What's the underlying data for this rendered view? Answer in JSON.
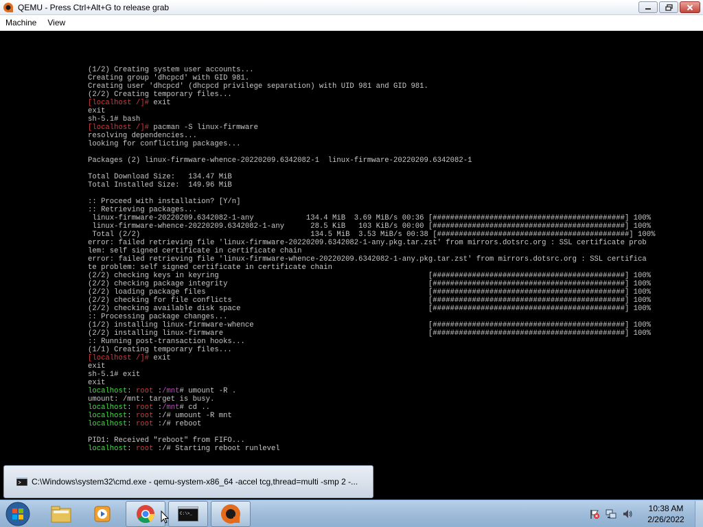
{
  "window": {
    "title": "QEMU - Press Ctrl+Alt+G to release grab",
    "menu": [
      "Machine",
      "View"
    ]
  },
  "terminal_lines": [
    [
      {
        "t": "(1/2) Creating system user accounts..."
      }
    ],
    [
      {
        "t": "Creating group 'dhcpcd' with GID 981."
      }
    ],
    [
      {
        "t": "Creating user 'dhcpcd' (dhcpcd privilege separation) with UID 981 and GID 981."
      }
    ],
    [
      {
        "t": "(2/2) Creating temporary files..."
      }
    ],
    [
      {
        "t": "[localhost /]# ",
        "c": "red"
      },
      {
        "t": "exit"
      }
    ],
    [
      {
        "t": "exit"
      }
    ],
    [
      {
        "t": "sh-5.1# bash"
      }
    ],
    [
      {
        "t": "[localhost /]# ",
        "c": "red"
      },
      {
        "t": "pacman -S linux-firmware"
      }
    ],
    [
      {
        "t": "resolving dependencies..."
      }
    ],
    [
      {
        "t": "looking for conflicting packages..."
      }
    ],
    [
      {
        "t": ""
      }
    ],
    [
      {
        "t": "Packages (2) linux-firmware-whence-20220209.6342082-1  linux-firmware-20220209.6342082-1"
      }
    ],
    [
      {
        "t": ""
      }
    ],
    [
      {
        "t": "Total Download Size:   134.47 MiB"
      }
    ],
    [
      {
        "t": "Total Installed Size:  149.96 MiB"
      }
    ],
    [
      {
        "t": ""
      }
    ],
    [
      {
        "t": ":: Proceed with installation? [Y/n]"
      }
    ],
    [
      {
        "t": ":: Retrieving packages..."
      }
    ],
    [
      {
        "t": " linux-firmware-20220209.6342082-1-any            134.4 MiB  3.69 MiB/s 00:36 [############################################] 100%"
      }
    ],
    [
      {
        "t": " linux-firmware-whence-20220209.6342082-1-any      28.5 KiB   103 KiB/s 00:00 [############################################] 100%"
      }
    ],
    [
      {
        "t": " Total (2/2)                                       134.5 MiB  3.53 MiB/s 00:38 [############################################] 100%"
      }
    ],
    [
      {
        "t": "error: failed retrieving file 'linux-firmware-20220209.6342082-1-any.pkg.tar.zst' from mirrors.dotsrc.org : SSL certificate prob"
      }
    ],
    [
      {
        "t": "lem: self signed certificate in certificate chain"
      }
    ],
    [
      {
        "t": "error: failed retrieving file 'linux-firmware-whence-20220209.6342082-1-any.pkg.tar.zst' from mirrors.dotsrc.org : SSL certifica"
      }
    ],
    [
      {
        "t": "te problem: self signed certificate in certificate chain"
      }
    ],
    [
      {
        "t": "(2/2) checking keys in keyring                                                [############################################] 100%"
      }
    ],
    [
      {
        "t": "(2/2) checking package integrity                                              [############################################] 100%"
      }
    ],
    [
      {
        "t": "(2/2) loading package files                                                   [############################################] 100%"
      }
    ],
    [
      {
        "t": "(2/2) checking for file conflicts                                             [############################################] 100%"
      }
    ],
    [
      {
        "t": "(2/2) checking available disk space                                           [############################################] 100%"
      }
    ],
    [
      {
        "t": ":: Processing package changes..."
      }
    ],
    [
      {
        "t": "(1/2) installing linux-firmware-whence                                        [############################################] 100%"
      }
    ],
    [
      {
        "t": "(2/2) installing linux-firmware                                               [############################################] 100%"
      }
    ],
    [
      {
        "t": ":: Running post-transaction hooks..."
      }
    ],
    [
      {
        "t": "(1/1) Creating temporary files..."
      }
    ],
    [
      {
        "t": "[localhost /]# ",
        "c": "red"
      },
      {
        "t": "exit"
      }
    ],
    [
      {
        "t": "exit"
      }
    ],
    [
      {
        "t": "sh-5.1# exit"
      }
    ],
    [
      {
        "t": "exit"
      }
    ],
    [
      {
        "t": "localhost",
        "c": "grn"
      },
      {
        "t": ": "
      },
      {
        "t": "root",
        "c": "red"
      },
      {
        "t": " :"
      },
      {
        "t": "/mnt",
        "c": "mag"
      },
      {
        "t": "# umount -R ."
      }
    ],
    [
      {
        "t": "umount: /mnt: target is busy."
      }
    ],
    [
      {
        "t": "localhost",
        "c": "grn"
      },
      {
        "t": ": "
      },
      {
        "t": "root",
        "c": "red"
      },
      {
        "t": " :"
      },
      {
        "t": "/mnt",
        "c": "mag"
      },
      {
        "t": "# cd .."
      }
    ],
    [
      {
        "t": "localhost",
        "c": "grn"
      },
      {
        "t": ": "
      },
      {
        "t": "root",
        "c": "red"
      },
      {
        "t": " :/# umount -R mnt"
      }
    ],
    [
      {
        "t": "localhost",
        "c": "grn"
      },
      {
        "t": ": "
      },
      {
        "t": "root",
        "c": "red"
      },
      {
        "t": " :/# reboot"
      }
    ],
    [
      {
        "t": ""
      }
    ],
    [
      {
        "t": "PID1: Received \"reboot\" from FIFO..."
      }
    ],
    [
      {
        "t": "localhost",
        "c": "grn"
      },
      {
        "t": ": "
      },
      {
        "t": "root",
        "c": "red"
      },
      {
        "t": " :/# Starting reboot runlevel"
      }
    ]
  ],
  "preview": {
    "label": "C:\\Windows\\system32\\cmd.exe - qemu-system-x86_64  -accel tcg,thread=multi -smp 2 -..."
  },
  "taskbar": {
    "clock_time": "10:38 AM",
    "clock_date": "2/26/2022"
  }
}
